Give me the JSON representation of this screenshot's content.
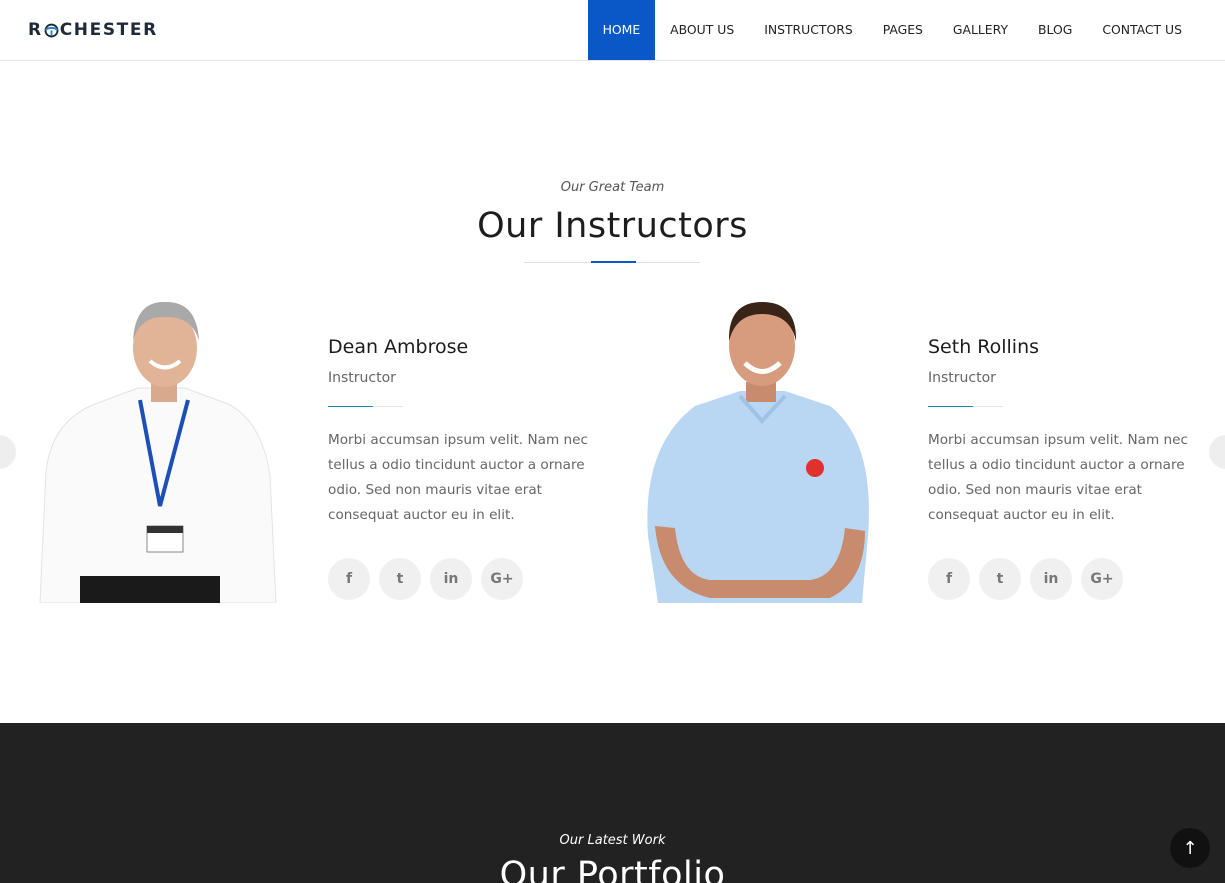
{
  "header": {
    "logo_prefix": "R",
    "logo_suffix": "CHESTER",
    "nav": [
      "HOME",
      "ABOUT US",
      "INSTRUCTORS",
      "PAGES",
      "GALLERY",
      "BLOG",
      "CONTACT US"
    ],
    "active_nav": "HOME"
  },
  "instructors_section": {
    "subtitle": "Our Great Team",
    "title": "Our Instructors",
    "instructors": [
      {
        "name": "Dean Ambrose",
        "role": "Instructor",
        "bio": "Morbi accumsan ipsum velit. Nam nec tellus a odio tincidunt auctor a ornare odio. Sed non mauris vitae erat consequat auctor eu in elit."
      },
      {
        "name": "Seth Rollins",
        "role": "Instructor",
        "bio": "Morbi accumsan ipsum velit. Nam nec tellus a odio tincidunt auctor a ornare odio. Sed non mauris vitae erat consequat auctor eu in elit."
      }
    ],
    "social_icons": {
      "facebook": "f",
      "twitter": "t",
      "linkedin": "in",
      "google_plus": "G+"
    }
  },
  "portfolio_section": {
    "subtitle": "Our Latest Work",
    "title": "Our Portfolio"
  },
  "back_to_top": "↑",
  "colors": {
    "accent": "#0a58c7",
    "dark_bg": "#222222"
  }
}
